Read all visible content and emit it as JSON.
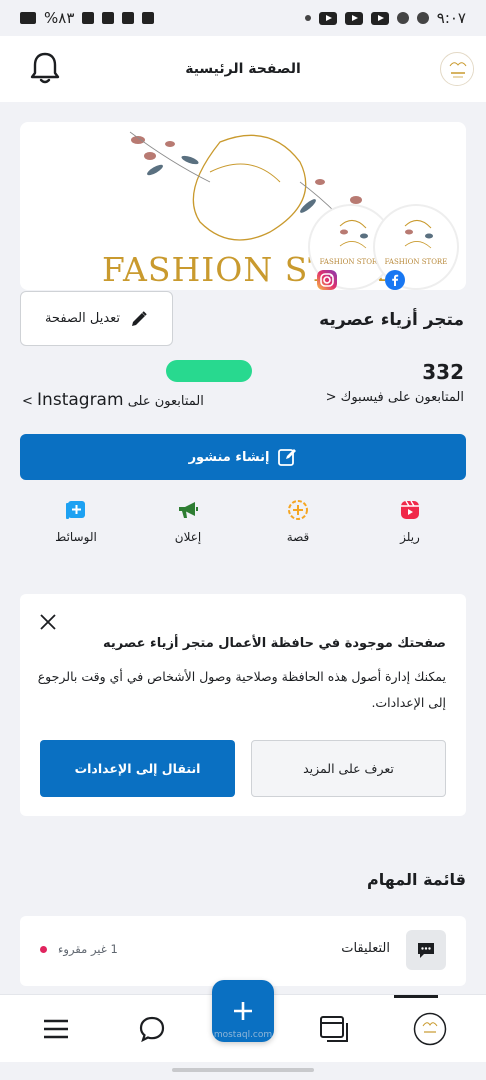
{
  "status_bar": {
    "time": "٩:٠٧",
    "battery": "%٨٣"
  },
  "header": {
    "title": "الصفحة الرئيسية"
  },
  "cover": {
    "brand_text": "FASHION STORE",
    "profile_label": "FASHION STORE"
  },
  "page": {
    "edit_label": "تعديل الصفحة",
    "name": "متجر أزياء عصريه",
    "fb_followers_count": "332",
    "fb_followers_label": "المتابعون على فيسبوك",
    "ig_followers_label": "المتابعون على",
    "ig_name": "Instagram",
    "chevron": "<"
  },
  "create_post": {
    "label": "إنشاء منشور"
  },
  "actions": {
    "reels": "ريلز",
    "story": "قصة",
    "ad": "إعلان",
    "media": "الوسائط"
  },
  "business_portfolio": {
    "title": "صفحتك موجودة في حافظة الأعمال متجر أزياء عصريه",
    "body": "يمكنك إدارة أصول هذه الحافظة وصلاحية وصول الأشخاص في أي وقت بالرجوع إلى الإعدادات.",
    "settings_button": "انتقال إلى الإعدادات",
    "learn_more_button": "تعرف على المزيد"
  },
  "tasks": {
    "heading": "قائمة المهام",
    "items": [
      {
        "label": "التعليقات",
        "unread": "1 غير مقروء"
      }
    ]
  },
  "bottom_nav": {
    "watermark": "mostaql.com"
  },
  "colors": {
    "accent": "#0a70c2",
    "background": "#f1f2f6",
    "unread_dot": "#e0245e",
    "brand_gold": "#c99a2e"
  }
}
